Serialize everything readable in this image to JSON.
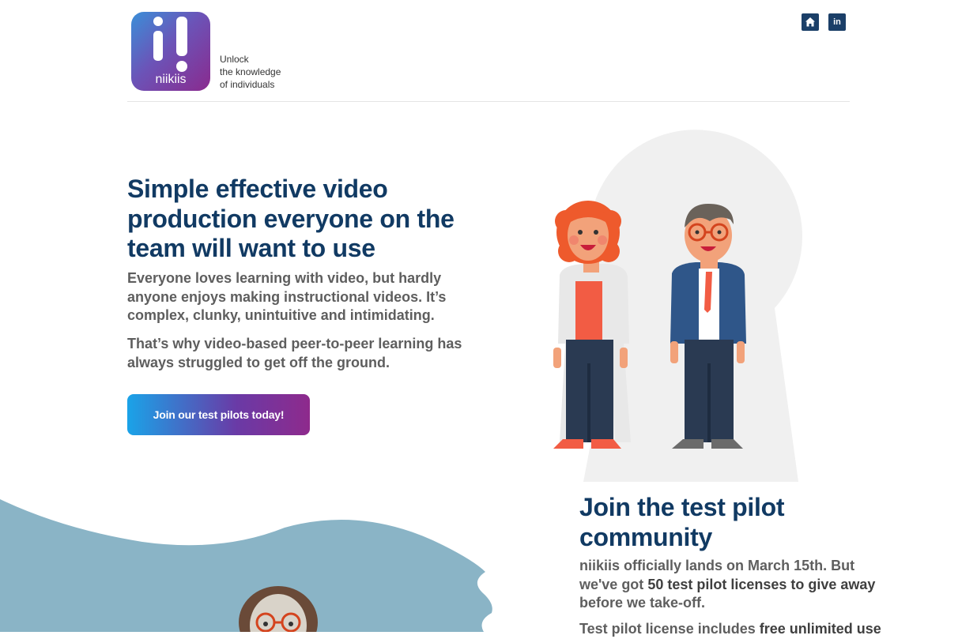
{
  "brand": {
    "logo_word": "niikiis",
    "tagline": [
      "Unlock",
      "the knowledge",
      "of individuals"
    ]
  },
  "header": {
    "home_icon": "home-icon",
    "linkedin_icon": "linkedin-icon",
    "linkedin_glyph": "in"
  },
  "hero": {
    "title": "Simple effective video production everyone on the team will want to use",
    "para1": "Everyone loves learning with video, but hardly anyone enjoys making instructional videos. It’s complex, clunky, unintuitive and intimidating.",
    "para2": "That’s why video-based peer-to-peer learning has always struggled to get off the ground.",
    "cta_label": "Join our test pilots today!"
  },
  "join": {
    "title": "Join the test pilot community",
    "para_a": "niikiis officially lands on March 15th. But we've got ",
    "para_bold": "50 test pilot licenses to give away",
    "para_b": " before we take-off.",
    "para2_a": "Test pilot license includes ",
    "para2_bold": "free unlimited use"
  },
  "colors": {
    "heading": "#113a63",
    "body_text": "#5e5e5e",
    "social_bg": "#1b3f68",
    "wave": "#8ab4c6",
    "keyhole": "#f0f0f0",
    "cta_gradient": [
      "#1aa3e8",
      "#8e2a8c"
    ]
  }
}
